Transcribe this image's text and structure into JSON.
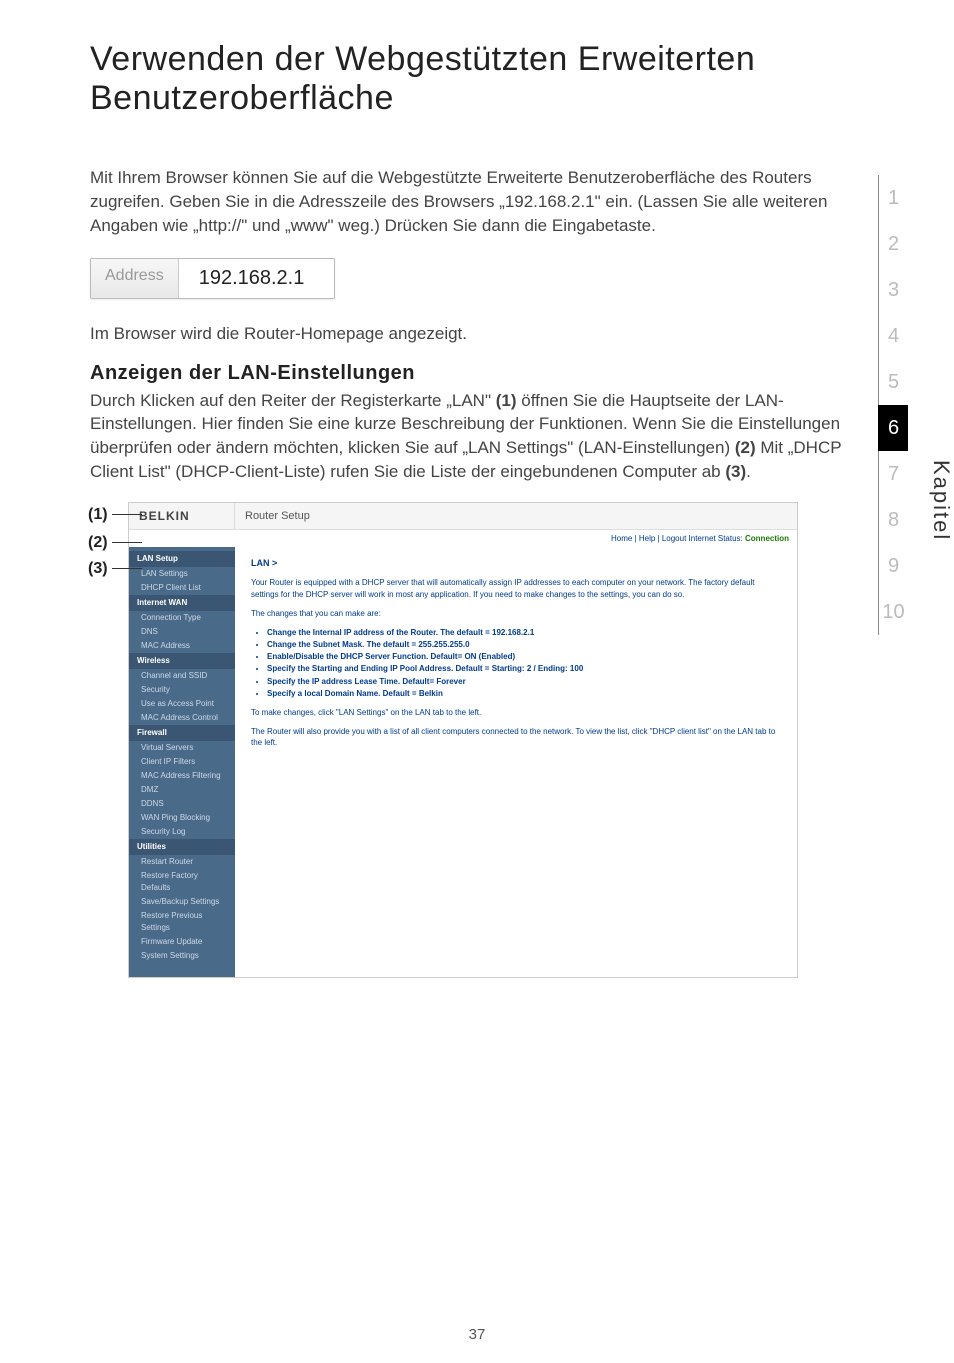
{
  "page_title": "Verwenden der Webgestützten Erweiterten Benutzeroberfläche",
  "intro": "Mit Ihrem Browser können Sie auf die Webgestützte Erweiterte Benutzeroberfläche des Routers zugreifen. Geben Sie in die Adresszeile des Browsers „192.168.2.1\" ein. (Lassen Sie alle weiteren Angaben wie „http://\" und „www\" weg.) Drücken Sie dann die Eingabetaste.",
  "address_label": "Address",
  "address_value": "192.168.2.1",
  "below_intro": "Im Browser wird die Router-Homepage angezeigt.",
  "section_heading": "Anzeigen der LAN-Einstellungen",
  "section_body_1": "Durch Klicken auf den Reiter der Registerkarte „LAN\" ",
  "section_body_1b": " öffnen Sie die Hauptseite der LAN-Einstellungen. Hier finden Sie eine kurze Beschreibung der Funktionen. Wenn Sie die Einstellungen überprüfen oder ändern möchten, klicken Sie auf „LAN Settings\" (LAN-Einstellungen) ",
  "section_body_2": " Mit „DHCP Client List\" (DHCP-Client-Liste) rufen Sie die Liste der eingebundenen Computer ab ",
  "ref1": "(1)",
  "ref2": "(2)",
  "ref3": "(3)",
  "period": ".",
  "side_label": "Kapitel",
  "rail": [
    "1",
    "2",
    "3",
    "4",
    "5",
    "6",
    "7",
    "8",
    "9",
    "10"
  ],
  "rail_active_index": 5,
  "page_number": "37",
  "router": {
    "logo": "BELKIN",
    "title": "Router Setup",
    "status_prefix": "Home | Help | Logout   Internet Status: ",
    "status_value": "Connection",
    "crumb": "LAN >",
    "p1": "Your Router is equipped with a DHCP server that will automatically assign IP addresses to each computer on your network. The factory default settings for the DHCP server will work in most any application. If you need to make changes to the settings, you can do so.",
    "p2": "The changes that you can make are:",
    "bullets": [
      "Change the Internal IP address of the Router. The default = 192.168.2.1",
      "Change the Subnet Mask. The default = 255.255.255.0",
      "Enable/Disable the DHCP Server Function. Default= ON (Enabled)",
      "Specify the Starting and Ending IP Pool Address. Default = Starting: 2 / Ending: 100",
      "Specify the IP address Lease Time. Default= Forever",
      "Specify a local Domain Name. Default = Belkin"
    ],
    "p3": "To make changes, click \"LAN Settings\" on the LAN tab to the left.",
    "p4": "The Router will also provide you with a list of all client computers connected to the network. To view the list, click \"DHCP client list\" on the LAN tab to the left.",
    "nav": [
      {
        "type": "group",
        "label": "LAN Setup"
      },
      {
        "type": "item",
        "label": "LAN Settings"
      },
      {
        "type": "item",
        "label": "DHCP Client List"
      },
      {
        "type": "group",
        "label": "Internet WAN"
      },
      {
        "type": "item",
        "label": "Connection Type"
      },
      {
        "type": "item",
        "label": "DNS"
      },
      {
        "type": "item",
        "label": "MAC Address"
      },
      {
        "type": "group",
        "label": "Wireless"
      },
      {
        "type": "item",
        "label": "Channel and SSID"
      },
      {
        "type": "item",
        "label": "Security"
      },
      {
        "type": "item",
        "label": "Use as Access Point"
      },
      {
        "type": "item",
        "label": "MAC Address Control"
      },
      {
        "type": "group",
        "label": "Firewall"
      },
      {
        "type": "item",
        "label": "Virtual Servers"
      },
      {
        "type": "item",
        "label": "Client IP Filters"
      },
      {
        "type": "item",
        "label": "MAC Address Filtering"
      },
      {
        "type": "item",
        "label": "DMZ"
      },
      {
        "type": "item",
        "label": "DDNS"
      },
      {
        "type": "item",
        "label": "WAN Ping Blocking"
      },
      {
        "type": "item",
        "label": "Security Log"
      },
      {
        "type": "group",
        "label": "Utilities"
      },
      {
        "type": "item",
        "label": "Restart Router"
      },
      {
        "type": "item",
        "label": "Restore Factory Defaults"
      },
      {
        "type": "item",
        "label": "Save/Backup Settings"
      },
      {
        "type": "item",
        "label": "Restore Previous Settings"
      },
      {
        "type": "item",
        "label": "Firmware Update"
      },
      {
        "type": "item",
        "label": "System Settings"
      }
    ]
  }
}
